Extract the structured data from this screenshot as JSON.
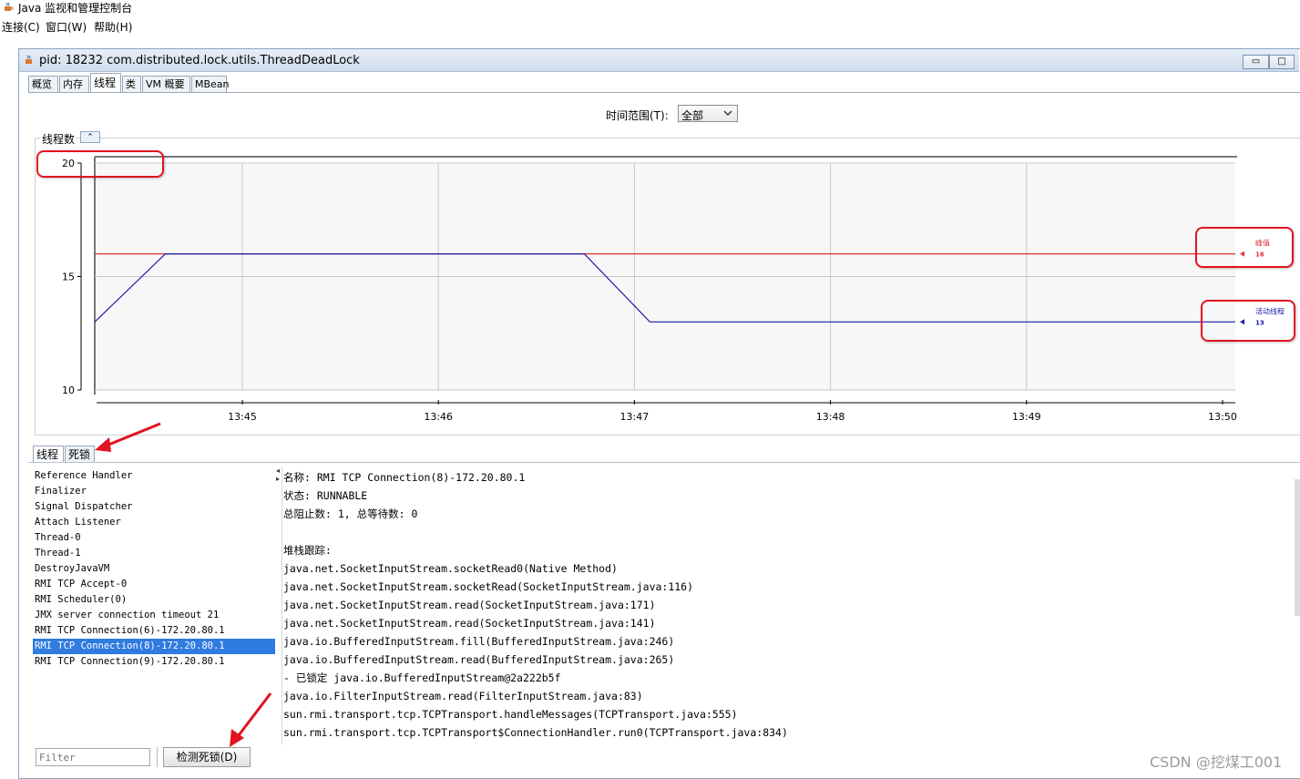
{
  "app": {
    "title": "Java 监视和管理控制台",
    "menus": [
      "连接(C)",
      "窗口(W)",
      "帮助(H)"
    ]
  },
  "window": {
    "title": "pid: 18232 com.distributed.lock.utils.ThreadDeadLock",
    "buttons": [
      "restore",
      "maximize",
      "close"
    ]
  },
  "tabs": [
    "概览",
    "内存",
    "线程",
    "类",
    "VM 概要",
    "MBean"
  ],
  "active_tab": "线程",
  "time_range": {
    "label": "时间范围(T):",
    "value": "全部"
  },
  "chart": {
    "caption": "线程数",
    "collapse_icon": "chevron-up-double-icon"
  },
  "chart_data": {
    "type": "line",
    "title": "线程数",
    "x": [
      "13:45",
      "13:46",
      "13:47",
      "13:48",
      "13:49",
      "13:50"
    ],
    "yticks": [
      10,
      15,
      20
    ],
    "ylim": [
      10,
      20
    ],
    "series": [
      {
        "name": "峰值",
        "color": "#e03030",
        "value_label": "16",
        "points": [
          [
            13.72,
            16
          ],
          [
            13.833,
            16
          ]
        ]
      },
      {
        "name": "活动线程",
        "color": "#1a1aa8",
        "value_label": "13",
        "points": [
          [
            13.72,
            13
          ],
          [
            13.727,
            16
          ],
          [
            13.7685,
            16
          ],
          [
            13.775,
            13
          ],
          [
            13.833,
            13
          ]
        ]
      }
    ],
    "grid": true
  },
  "bottom_tabs": [
    "线程",
    "死锁"
  ],
  "threads": [
    "Reference Handler",
    "Finalizer",
    "Signal Dispatcher",
    "Attach Listener",
    "Thread-0",
    "Thread-1",
    "DestroyJavaVM",
    "RMI TCP Accept-0",
    "RMI Scheduler(0)",
    "JMX server connection timeout 21",
    "RMI TCP Connection(6)-172.20.80.1",
    "RMI TCP Connection(8)-172.20.80.1",
    "RMI TCP Connection(9)-172.20.80.1"
  ],
  "selected_thread": "RMI TCP Connection(8)-172.20.80.1",
  "detail_lines": [
    "名称: RMI TCP Connection(8)-172.20.80.1",
    "状态: RUNNABLE",
    "总阻止数: 1, 总等待数: 0",
    "",
    "堆栈跟踪:",
    "java.net.SocketInputStream.socketRead0(Native Method)",
    "java.net.SocketInputStream.socketRead(SocketInputStream.java:116)",
    "java.net.SocketInputStream.read(SocketInputStream.java:171)",
    "java.net.SocketInputStream.read(SocketInputStream.java:141)",
    "java.io.BufferedInputStream.fill(BufferedInputStream.java:246)",
    "java.io.BufferedInputStream.read(BufferedInputStream.java:265)",
    "   - 已锁定 java.io.BufferedInputStream@2a222b5f",
    "java.io.FilterInputStream.read(FilterInputStream.java:83)",
    "sun.rmi.transport.tcp.TCPTransport.handleMessages(TCPTransport.java:555)",
    "sun.rmi.transport.tcp.TCPTransport$ConnectionHandler.run0(TCPTransport.java:834)"
  ],
  "filter": {
    "placeholder": "Filter"
  },
  "detect_button": "检测死锁(D)",
  "watermark": "CSDN @挖煤工001",
  "colors": {
    "selection": "#2f7be0",
    "annotation": "#e0141f",
    "peak": "#e03030",
    "live": "#1a1aa8"
  }
}
